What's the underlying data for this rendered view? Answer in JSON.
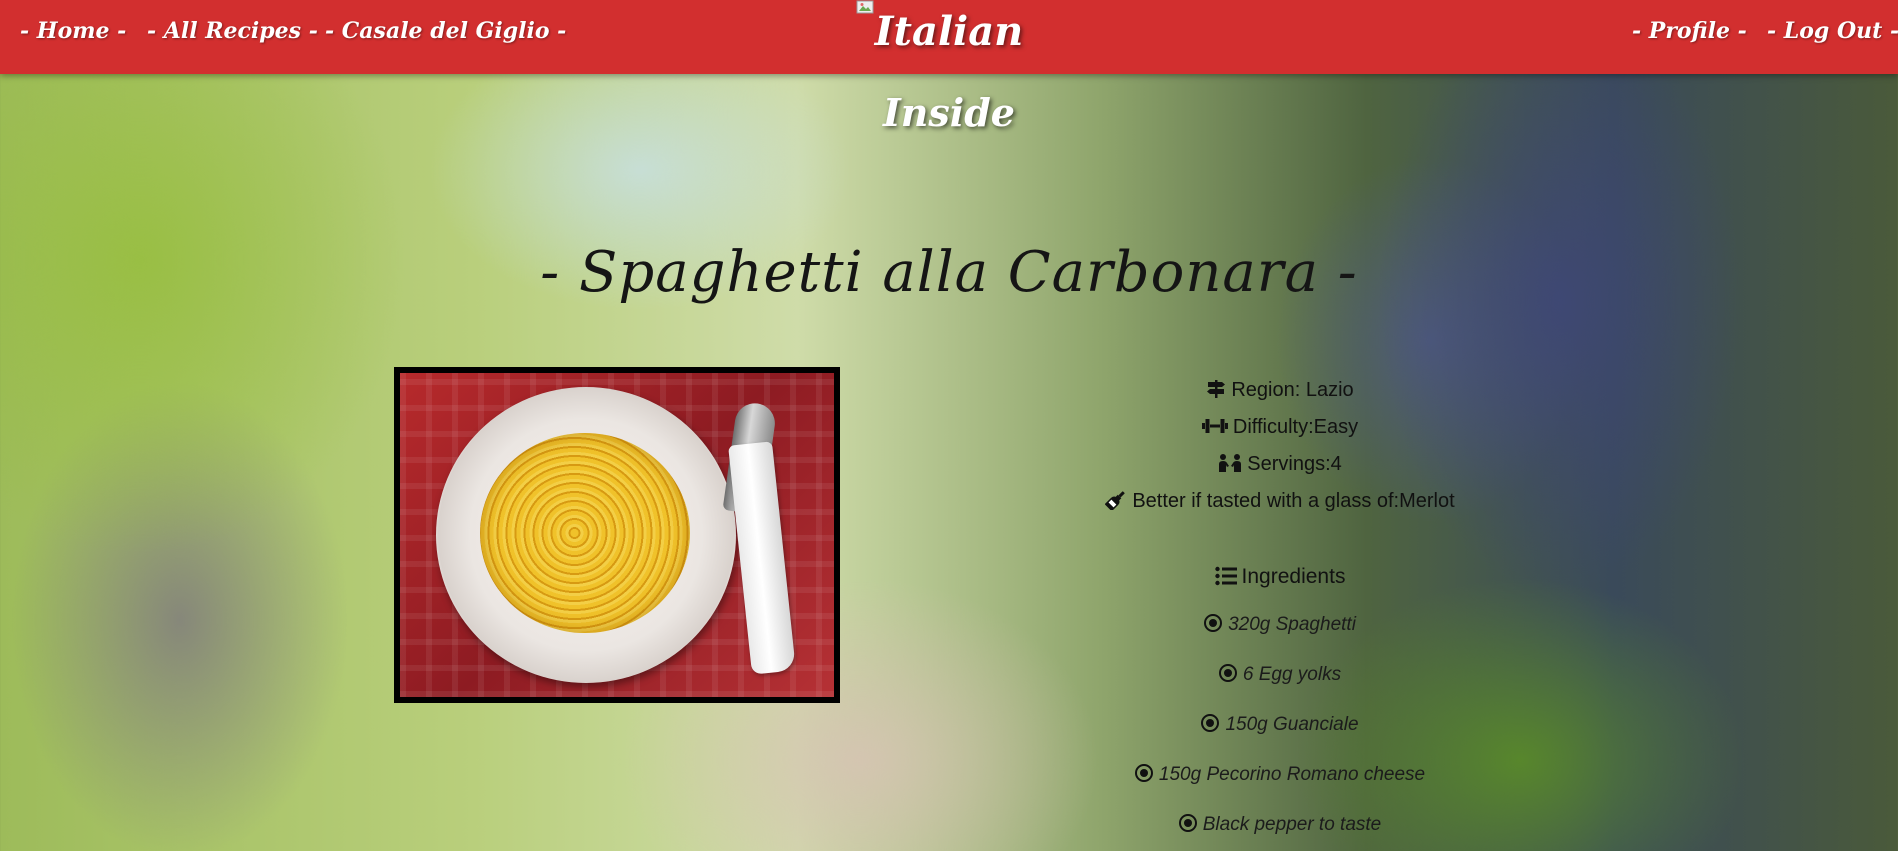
{
  "nav": {
    "home": "- Home -",
    "all_recipes": "- All Recipes -",
    "casale": "- Casale del Giglio -",
    "brand": "Italian",
    "profile": "- Profile -",
    "logout": "- Log Out -"
  },
  "subtitle": "Inside",
  "recipe": {
    "title": "- Spaghetti alla Carbonara -",
    "region": "Region: Lazio",
    "difficulty": "Difficulty:Easy",
    "servings": "Servings:4",
    "wine": "Better if tasted with a glass of:Merlot",
    "ingredients_label": "Ingredients",
    "ingredients": [
      "320g Spaghetti",
      "6 Egg yolks",
      "150g Guanciale",
      "150g Pecorino Romano cheese",
      "Black pepper to taste"
    ]
  },
  "colors": {
    "navbar": "#d22f2f",
    "text_dark": "#151515",
    "text_light": "#ffffff"
  },
  "icons": {
    "region": "signpost-icon",
    "difficulty": "dumbbell-icon",
    "servings": "people-icon",
    "wine": "wine-bottle-icon",
    "ingredients": "list-icon",
    "ingredient_bullet": "dot-circle-icon"
  }
}
